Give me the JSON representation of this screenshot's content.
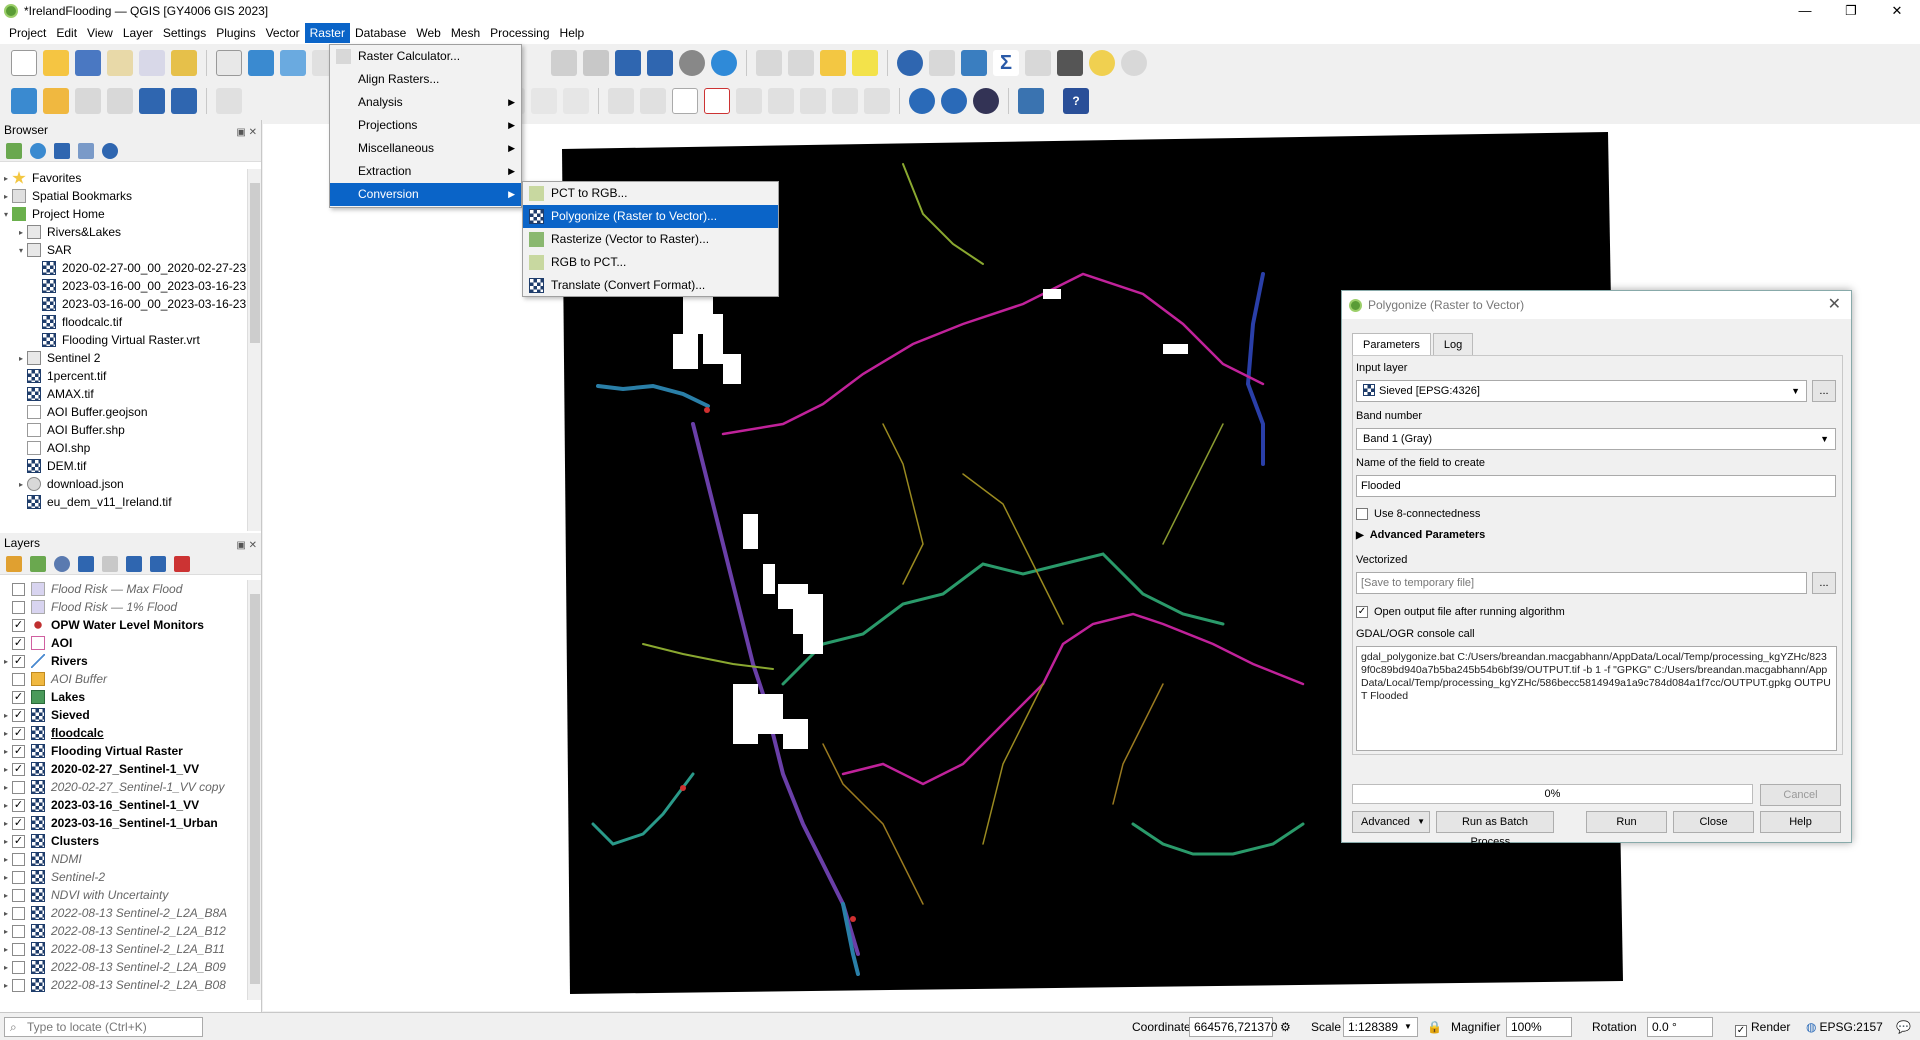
{
  "window": {
    "title": "*IrelandFlooding — QGIS [GY4006 GIS 2023]",
    "controls": [
      "—",
      "❐",
      "✕"
    ]
  },
  "menubar": [
    "Project",
    "Edit",
    "View",
    "Layer",
    "Settings",
    "Plugins",
    "Vector",
    "Raster",
    "Database",
    "Web",
    "Mesh",
    "Processing",
    "Help"
  ],
  "raster_menu": {
    "items": [
      {
        "label": "Raster Calculator...",
        "submenu": false
      },
      {
        "label": "Align Rasters...",
        "submenu": false
      },
      {
        "label": "Analysis",
        "submenu": true
      },
      {
        "label": "Projections",
        "submenu": true
      },
      {
        "label": "Miscellaneous",
        "submenu": true
      },
      {
        "label": "Extraction",
        "submenu": true
      },
      {
        "label": "Conversion",
        "submenu": true
      }
    ]
  },
  "conversion_menu": {
    "items": [
      {
        "label": "PCT to RGB..."
      },
      {
        "label": "Polygonize (Raster to Vector)..."
      },
      {
        "label": "Rasterize (Vector to Raster)..."
      },
      {
        "label": "RGB to PCT..."
      },
      {
        "label": "Translate (Convert Format)..."
      }
    ]
  },
  "browser": {
    "title": "Browser",
    "items": [
      {
        "label": "Favorites",
        "indent": 0,
        "arrow": "▸",
        "icon": "star-icon"
      },
      {
        "label": "Spatial Bookmarks",
        "indent": 0,
        "arrow": "▸",
        "icon": "bookmark-icon"
      },
      {
        "label": "Project Home",
        "indent": 0,
        "arrow": "▾",
        "icon": "folder-green-icon"
      },
      {
        "label": "Rivers&Lakes",
        "indent": 1,
        "arrow": "▸",
        "icon": "folder-icon"
      },
      {
        "label": "SAR",
        "indent": 1,
        "arrow": "▾",
        "icon": "folder-icon"
      },
      {
        "label": "2020-02-27-00_00_2020-02-27-23",
        "indent": 2,
        "arrow": "",
        "icon": "raster-icon"
      },
      {
        "label": "2023-03-16-00_00_2023-03-16-23",
        "indent": 2,
        "arrow": "",
        "icon": "raster-icon"
      },
      {
        "label": "2023-03-16-00_00_2023-03-16-23",
        "indent": 2,
        "arrow": "",
        "icon": "raster-icon"
      },
      {
        "label": "floodcalc.tif",
        "indent": 2,
        "arrow": "",
        "icon": "raster-icon"
      },
      {
        "label": "Flooding Virtual Raster.vrt",
        "indent": 2,
        "arrow": "",
        "icon": "raster-icon"
      },
      {
        "label": "Sentinel 2",
        "indent": 1,
        "arrow": "▸",
        "icon": "folder-icon"
      },
      {
        "label": "1percent.tif",
        "indent": 1,
        "arrow": "",
        "icon": "raster-icon"
      },
      {
        "label": "AMAX.tif",
        "indent": 1,
        "arrow": "",
        "icon": "raster-icon"
      },
      {
        "label": "AOI Buffer.geojson",
        "indent": 1,
        "arrow": "",
        "icon": "vector-icon"
      },
      {
        "label": "AOI Buffer.shp",
        "indent": 1,
        "arrow": "",
        "icon": "vector-icon"
      },
      {
        "label": "AOI.shp",
        "indent": 1,
        "arrow": "",
        "icon": "vector-icon"
      },
      {
        "label": "DEM.tif",
        "indent": 1,
        "arrow": "",
        "icon": "raster-icon"
      },
      {
        "label": "download.json",
        "indent": 1,
        "arrow": "▸",
        "icon": "db-icon"
      },
      {
        "label": "eu_dem_v11_Ireland.tif",
        "indent": 1,
        "arrow": "",
        "icon": "raster-icon"
      }
    ]
  },
  "layers": {
    "title": "Layers",
    "items": [
      {
        "label": "Flood Risk — Max Flood",
        "checked": false,
        "style": "italic",
        "icon": "fill-lavender",
        "arrow": ""
      },
      {
        "label": "Flood Risk — 1% Flood",
        "checked": false,
        "style": "italic",
        "icon": "fill-lavender",
        "arrow": ""
      },
      {
        "label": "OPW Water Level Monitors",
        "checked": true,
        "style": "bold",
        "icon": "point-red",
        "arrow": ""
      },
      {
        "label": "AOI",
        "checked": true,
        "style": "bold",
        "icon": "fill-pink-outline",
        "arrow": ""
      },
      {
        "label": "Rivers",
        "checked": true,
        "style": "bold",
        "icon": "line-icon",
        "arrow": "▸"
      },
      {
        "label": "AOI Buffer",
        "checked": false,
        "style": "italic",
        "icon": "fill-orange",
        "arrow": ""
      },
      {
        "label": "Lakes",
        "checked": true,
        "style": "bold",
        "icon": "fill-green",
        "arrow": ""
      },
      {
        "label": "Sieved",
        "checked": true,
        "style": "bold",
        "icon": "raster",
        "arrow": "▸"
      },
      {
        "label": "floodcalc",
        "checked": true,
        "style": "bold-underline",
        "icon": "raster",
        "arrow": "▸"
      },
      {
        "label": "Flooding Virtual Raster",
        "checked": true,
        "style": "bold",
        "icon": "raster",
        "arrow": "▸"
      },
      {
        "label": "2020-02-27_Sentinel-1_VV",
        "checked": true,
        "style": "bold",
        "icon": "raster",
        "arrow": "▸"
      },
      {
        "label": "2020-02-27_Sentinel-1_VV copy",
        "checked": false,
        "style": "italic",
        "icon": "raster",
        "arrow": "▸"
      },
      {
        "label": "2023-03-16_Sentinel-1_VV",
        "checked": true,
        "style": "bold",
        "icon": "raster",
        "arrow": "▸"
      },
      {
        "label": "2023-03-16_Sentinel-1_Urban",
        "checked": true,
        "style": "bold",
        "icon": "raster",
        "arrow": "▸"
      },
      {
        "label": "Clusters",
        "checked": true,
        "style": "bold",
        "icon": "raster",
        "arrow": "▸"
      },
      {
        "label": "NDMI",
        "checked": false,
        "style": "italic",
        "icon": "raster",
        "arrow": "▸"
      },
      {
        "label": "Sentinel-2",
        "checked": false,
        "style": "italic",
        "icon": "raster",
        "arrow": "▸"
      },
      {
        "label": "NDVI with Uncertainty",
        "checked": false,
        "style": "italic",
        "icon": "raster",
        "arrow": "▸"
      },
      {
        "label": "2022-08-13 Sentinel-2_L2A_B8A",
        "checked": false,
        "style": "italic",
        "icon": "raster",
        "arrow": "▸"
      },
      {
        "label": "2022-08-13 Sentinel-2_L2A_B12",
        "checked": false,
        "style": "italic",
        "icon": "raster",
        "arrow": "▸"
      },
      {
        "label": "2022-08-13 Sentinel-2_L2A_B11",
        "checked": false,
        "style": "italic",
        "icon": "raster",
        "arrow": "▸"
      },
      {
        "label": "2022-08-13 Sentinel-2_L2A_B09",
        "checked": false,
        "style": "italic",
        "icon": "raster",
        "arrow": "▸"
      },
      {
        "label": "2022-08-13 Sentinel-2_L2A_B08",
        "checked": false,
        "style": "italic",
        "icon": "raster",
        "arrow": "▸"
      }
    ]
  },
  "dialog": {
    "title": "Polygonize (Raster to Vector)",
    "tabs": [
      "Parameters",
      "Log"
    ],
    "input_layer_label": "Input layer",
    "input_layer_value": "Sieved [EPSG:4326]",
    "band_label": "Band number",
    "band_value": "Band 1 (Gray)",
    "field_label": "Name of the field to create",
    "field_value": "Flooded",
    "connectedness_label": "Use 8-connectedness",
    "advanced_label": "Advanced Parameters",
    "vectorized_label": "Vectorized",
    "vectorized_placeholder": "[Save to temporary file]",
    "open_output_label": "Open output file after running algorithm",
    "console_label": "GDAL/OGR console call",
    "console_text": "gdal_polygonize.bat C:/Users/breandan.macgabhann/AppData/Local/Temp/processing_kgYZHc/8239f0c89bd940a7b5ba245b54b6bf39/OUTPUT.tif -b 1 -f \"GPKG\" C:/Users/breandan.macgabhann/AppData/Local/Temp/processing_kgYZHc/586becc5814949a1a9c784d084a1f7cc/OUTPUT.gpkg OUTPUT Flooded",
    "progress": "0%",
    "cancel": "Cancel",
    "advanced_btn": "Advanced",
    "batch_btn": "Run as Batch Process...",
    "run_btn": "Run",
    "close_btn": "Close",
    "help_btn": "Help",
    "ellipsis": "..."
  },
  "statusbar": {
    "locate_placeholder": "Type to locate (Ctrl+K)",
    "coordinate_label": "Coordinate",
    "coordinate_value": "664576,721370",
    "scale_label": "Scale",
    "scale_value": "1:128389",
    "magnifier_label": "Magnifier",
    "magnifier_value": "100%",
    "rotation_label": "Rotation",
    "rotation_value": "0.0 °",
    "render_label": "Render",
    "crs_label": "EPSG:2157"
  }
}
